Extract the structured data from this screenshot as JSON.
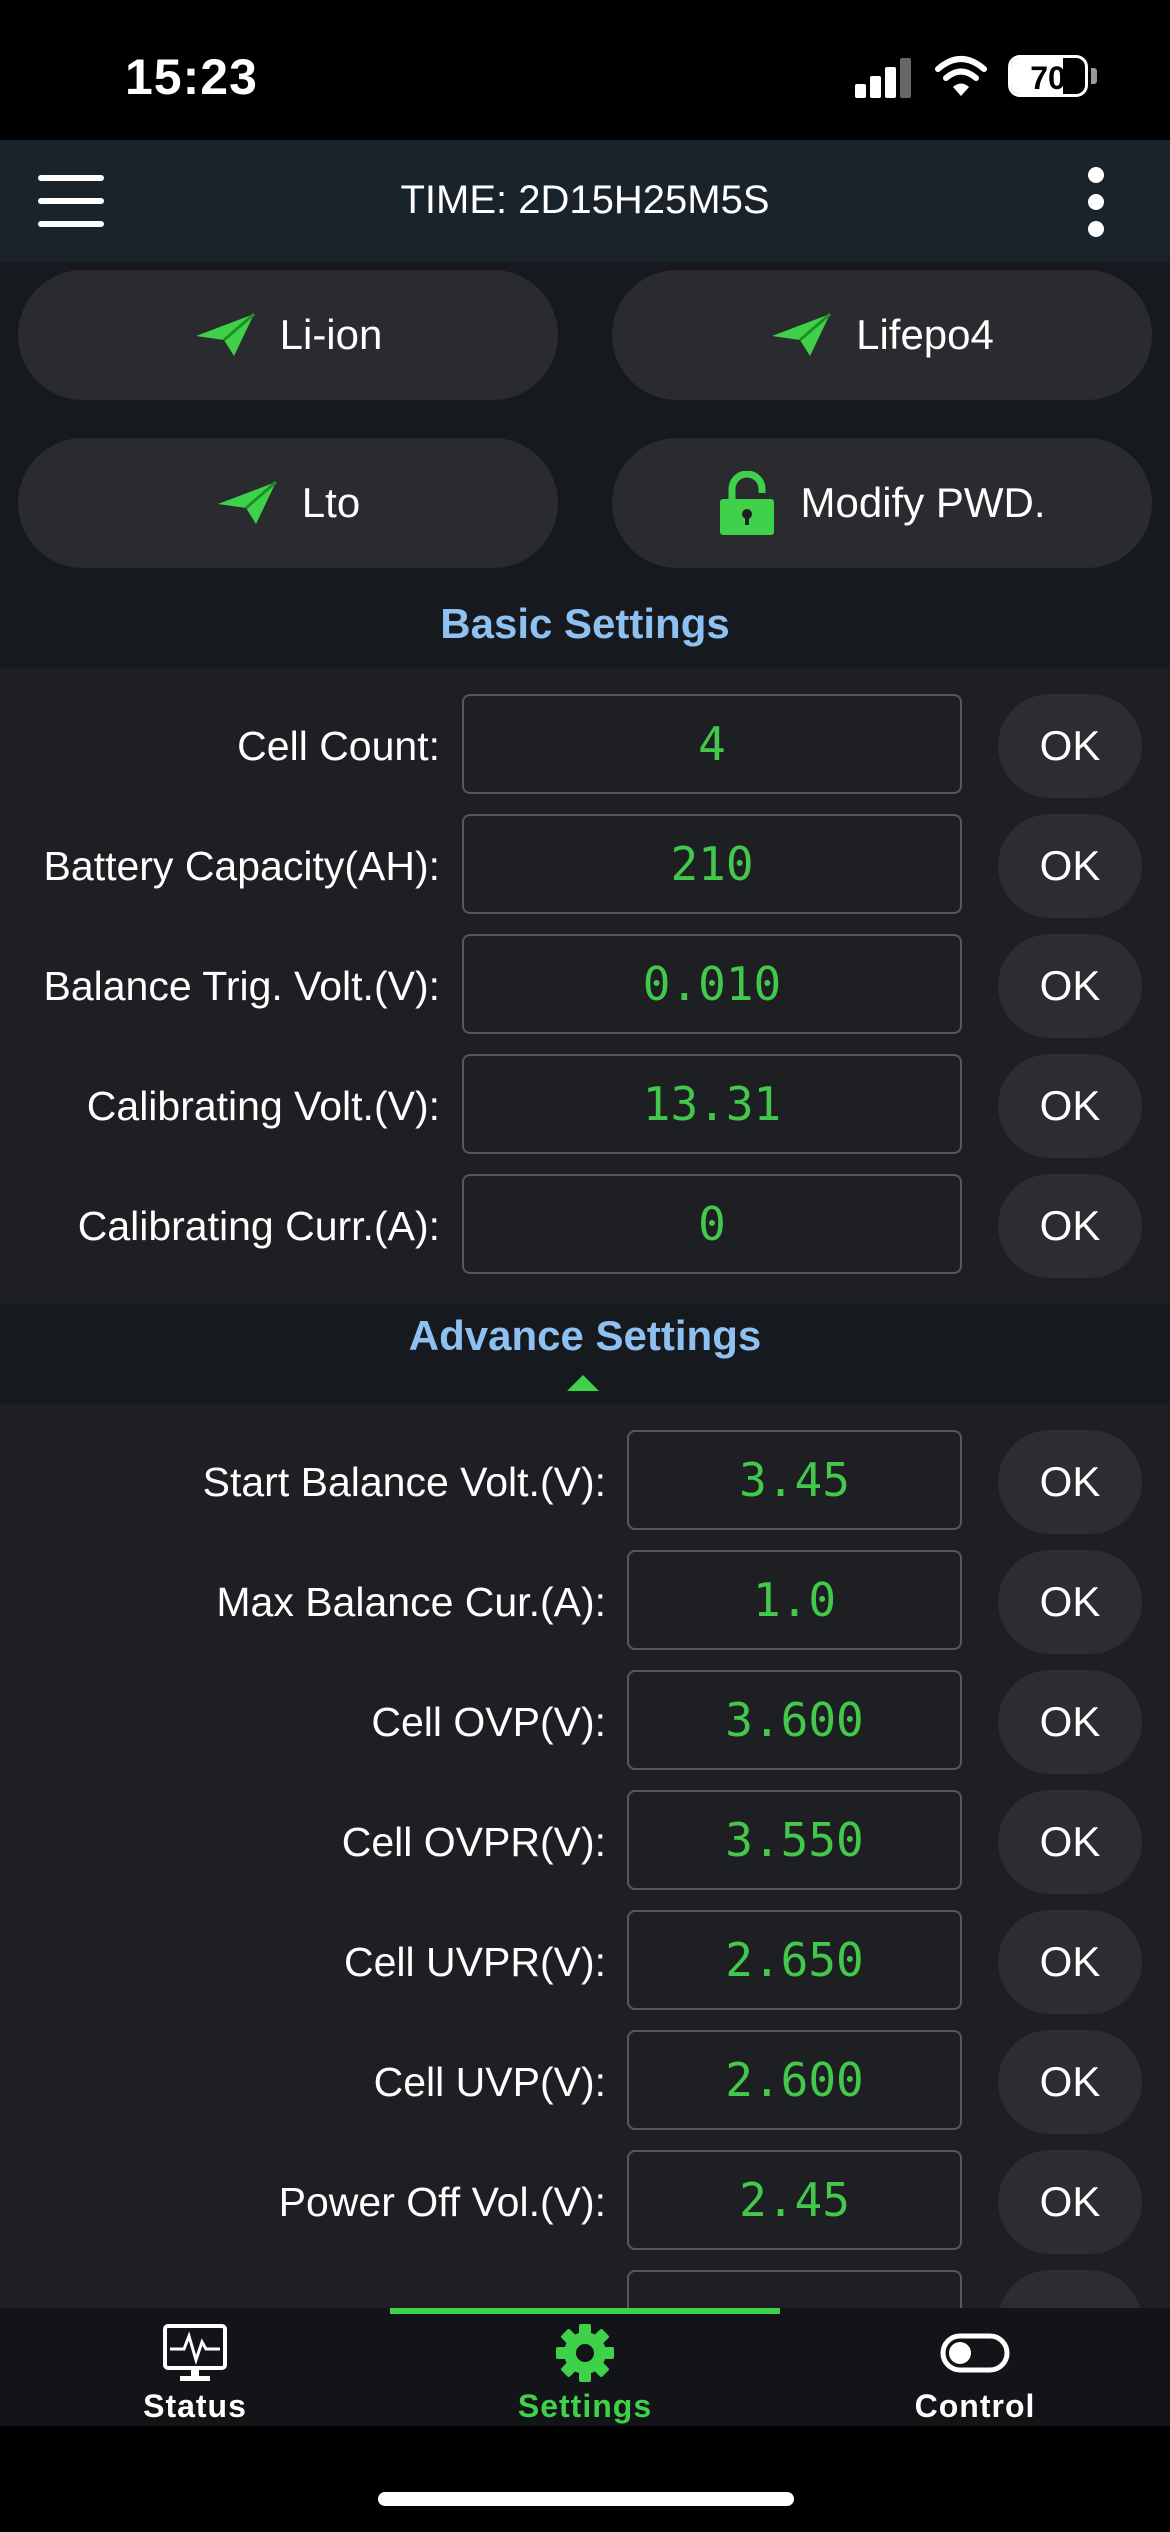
{
  "status_bar": {
    "time": "15:23",
    "battery": "70",
    "battery_level": 0.7
  },
  "header": {
    "title": "TIME: 2D15H25M5S"
  },
  "presets": [
    {
      "label": "Li-ion",
      "icon": "paper-plane-icon"
    },
    {
      "label": "Lifepo4",
      "icon": "paper-plane-icon"
    },
    {
      "label": "Lto",
      "icon": "paper-plane-icon"
    },
    {
      "label": "Modify PWD.",
      "icon": "lock-icon"
    }
  ],
  "basic": {
    "title": "Basic Settings",
    "ok_label": "OK",
    "rows": [
      {
        "label": "Cell Count:",
        "value": "4"
      },
      {
        "label": "Battery Capacity(AH):",
        "value": "210"
      },
      {
        "label": "Balance Trig. Volt.(V):",
        "value": "0.010"
      },
      {
        "label": "Calibrating Volt.(V):",
        "value": "13.31"
      },
      {
        "label": "Calibrating Curr.(A):",
        "value": "0"
      }
    ]
  },
  "advance": {
    "title": "Advance Settings",
    "ok_label": "OK",
    "rows": [
      {
        "label": "Start Balance Volt.(V):",
        "value": "3.45"
      },
      {
        "label": "Max Balance Cur.(A):",
        "value": "1.0"
      },
      {
        "label": "Cell OVP(V):",
        "value": "3.600"
      },
      {
        "label": "Cell OVPR(V):",
        "value": "3.550"
      },
      {
        "label": "Cell UVPR(V):",
        "value": "2.650"
      },
      {
        "label": "Cell UVP(V):",
        "value": "2.600"
      },
      {
        "label": "Power Off Vol.(V):",
        "value": "2.45"
      }
    ]
  },
  "tabs": [
    {
      "label": "Status",
      "icon": "monitor-pulse-icon"
    },
    {
      "label": "Settings",
      "icon": "gear-icon",
      "active": true
    },
    {
      "label": "Control",
      "icon": "toggle-icon"
    }
  ],
  "colors": {
    "accent_green": "#3fd14a",
    "value_green": "#42c84a",
    "section_title": "#8ec1f2"
  }
}
